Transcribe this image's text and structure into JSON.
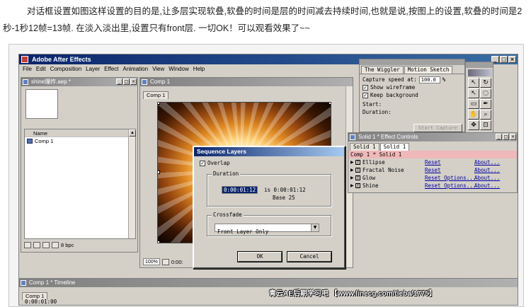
{
  "article": {
    "line1": "对话框设置如图这样设置的目的是,让多层实现软叠,软叠的时间是层的时间减去持续时间,也就是说,按图上的设置,软叠的时间是2",
    "line2": "秒-1秒12帧=13帧. 在淡入淡出里,设置只有front层. 一切OK！可以观看效果了~~"
  },
  "ae": {
    "app_title": "Adobe After Effects",
    "menu": [
      "File",
      "Edit",
      "Composition",
      "Layer",
      "Effect",
      "Animation",
      "View",
      "Window",
      "Help"
    ]
  },
  "project": {
    "title": "shine爆炸.aep *",
    "column_name": "Name",
    "items": [
      "Comp 1"
    ],
    "bpc": "8 bpc"
  },
  "comp": {
    "title": "Comp 1",
    "tab": "Comp 1",
    "zoom": "100%",
    "time": "0:00:"
  },
  "wiggler": {
    "tab1": "The Wiggler",
    "tab2": "Motion Sketch",
    "capture_speed_label": "Capture speed at:",
    "capture_speed_value": "100.0",
    "capture_speed_unit": "%",
    "show_wireframe": "Show wireframe",
    "keep_background": "Keep background",
    "start_label": "Start:",
    "duration_label": "Duration:",
    "start_capture": "Start Capture"
  },
  "effect_controls": {
    "title": "Solid 1 * Effect Controls",
    "tab1": "Solid 1",
    "tab2": "Solid 1",
    "header": "Comp 1 * Solid 1",
    "effects": [
      {
        "name": "Ellipse",
        "reset": "Reset",
        "about": "About..."
      },
      {
        "name": "Fractal Noise",
        "reset": "Reset",
        "about": "About..."
      },
      {
        "name": "Glow",
        "reset": "Reset Options...",
        "about": "About..."
      },
      {
        "name": "Shine",
        "reset": "Reset Options...",
        "about": "About..."
      }
    ]
  },
  "dialog": {
    "title": "Sequence Layers",
    "overlap_label": "Overlap",
    "duration_group": "Duration",
    "duration_value": "0:00:01:12",
    "is_text": "is 0:00:01:12",
    "base_text": "Base 25",
    "crossfade_group": "Crossfade",
    "crossfade_value": "Front Layer Only",
    "ok": "OK",
    "cancel": "Cancel"
  },
  "timeline": {
    "title": "Comp 1 * Timeline",
    "tab": "Comp 1",
    "time": "0:00:01:00"
  },
  "watermark": "青云AE后期学习吧 【www.linecg.com/tieba/1775】"
}
